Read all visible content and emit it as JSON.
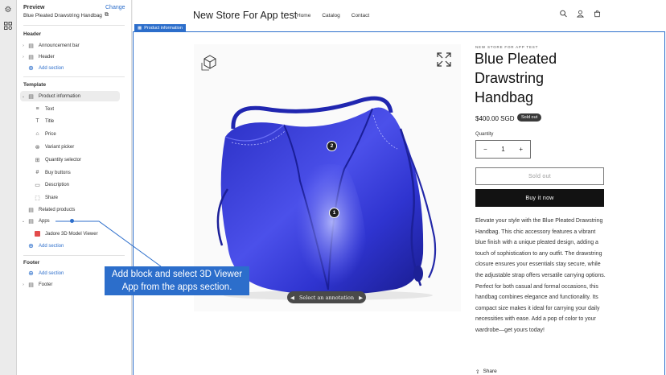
{
  "rail": {
    "icons": [
      "settings-icon",
      "apps-grid-icon"
    ]
  },
  "sidebar": {
    "preview_label": "Preview",
    "change_label": "Change",
    "product_name": "Blue Pleated Drawstring Handbag",
    "header": {
      "title": "Header",
      "items": [
        "Announcement bar",
        "Header"
      ],
      "add": "Add section"
    },
    "template": {
      "title": "Template",
      "section": "Product information",
      "blocks": [
        "Text",
        "Title",
        "Price",
        "Variant picker",
        "Quantity selector",
        "Buy buttons",
        "Description",
        "Share"
      ],
      "related": "Related products",
      "apps": "Apps",
      "app_block": "Jadore 3D Model Viewer",
      "add": "Add section"
    },
    "footer": {
      "title": "Footer",
      "add": "Add section",
      "item": "Footer"
    }
  },
  "store": {
    "title": "New Store For App test",
    "nav": [
      "Home",
      "Catalog",
      "Contact"
    ],
    "icons": [
      "search-icon",
      "account-icon",
      "cart-icon"
    ]
  },
  "selection_tag": "Product information",
  "product": {
    "vendor": "NEW STORE FOR APP TEST",
    "title": "Blue Pleated Drawstring Handbag",
    "price": "$400.00 SGD",
    "badge": "Sold out",
    "quantity_label": "Quantity",
    "quantity": "1",
    "minus": "−",
    "plus": "+",
    "sold_out_button": "Sold out",
    "buy_button": "Buy it now",
    "description": "Elevate your style with the Blue Pleated Drawstring Handbag. This chic accessory features a vibrant blue finish with a unique pleated design, adding a touch of sophistication to any outfit. The drawstring closure ensures your essentials stay secure, while the adjustable strap offers versatile carrying options. Perfect for both casual and formal occasions, this handbag combines elegance and functionality. Its compact size makes it ideal for carrying your daily necessities with ease. Add a pop of color to your wardrobe—get yours today!",
    "share": "Share"
  },
  "viewer": {
    "annotations": [
      "1",
      "2"
    ],
    "annotation_prompt": "Select an annotation"
  },
  "callout": "Add block and select 3D Viewer App from the apps section.",
  "colors": {
    "accent": "#2c6ecb",
    "bag": "#3a3fd6",
    "badge": "#3a3a3a"
  }
}
